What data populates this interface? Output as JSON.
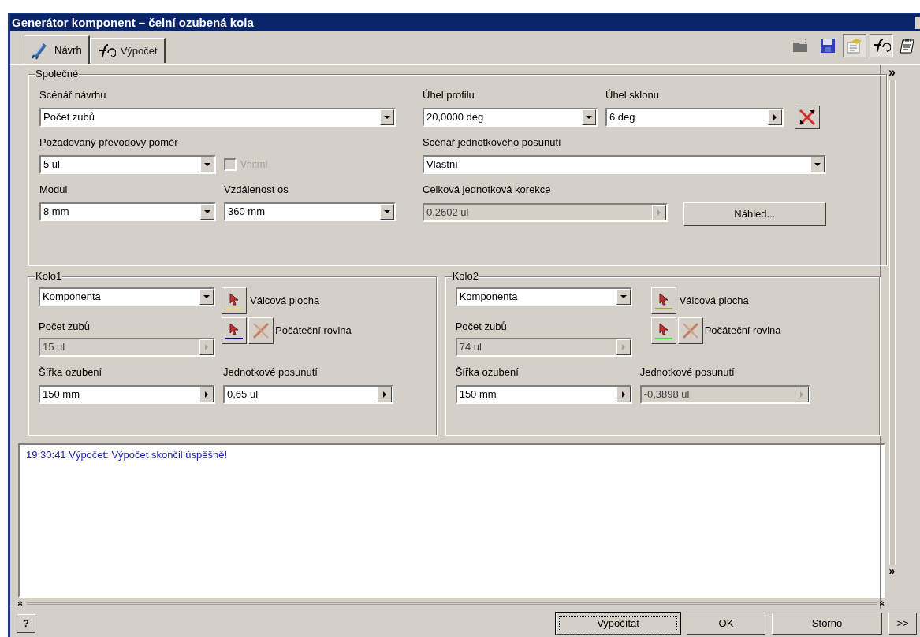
{
  "window": {
    "title": "Generátor komponent – čelní ozubená kola"
  },
  "tabs": [
    {
      "label": "Návrh",
      "selected": true
    },
    {
      "label": "Výpočet",
      "selected": false
    }
  ],
  "toolbar": [
    {
      "kind": "folder",
      "pressed": false
    },
    {
      "kind": "save",
      "pressed": false
    },
    {
      "kind": "note",
      "pressed": true
    },
    {
      "kind": "fx",
      "pressed": true
    },
    {
      "kind": "notepad",
      "pressed": false
    }
  ],
  "side_arrow": "»",
  "common": {
    "legend": "Společné",
    "design_scenario": {
      "label": "Scénář návrhu",
      "value": "Počet zubů",
      "kind": "combo",
      "disabled": false
    },
    "ratio": {
      "label": "Požadovaný převodový poměr",
      "value": "5 ul",
      "kind": "combo",
      "disabled": false
    },
    "internal": {
      "label": "Vnitřní",
      "checked": false,
      "disabled": true
    },
    "module": {
      "label": "Modul",
      "value": "8 mm",
      "kind": "combo",
      "disabled": false
    },
    "center_distance": {
      "label": "Vzdálenost os",
      "value": "360 mm",
      "kind": "combo",
      "disabled": false
    },
    "pressure_angle": {
      "label": "Úhel profilu",
      "value": "20,0000 deg",
      "kind": "combo",
      "disabled": false
    },
    "helix_angle": {
      "label": "Úhel sklonu",
      "value": "6 deg",
      "kind": "spin",
      "disabled": false
    },
    "shift_scenario": {
      "label": "Scénář jednotkového posunutí",
      "value": "Vlastní",
      "kind": "combo",
      "disabled": false
    },
    "total_correction": {
      "label": "Celková jednotková korekce",
      "value": "0,2602 ul",
      "kind": "spin",
      "disabled": true
    },
    "preview_button": "Náhled..."
  },
  "gears": [
    {
      "legend": "Kolo1",
      "type": {
        "value": "Komponenta",
        "kind": "combo",
        "disabled": false
      },
      "cylinder": {
        "label": "Válcová plocha",
        "color": "#e8dc70"
      },
      "start_plane": {
        "label": "Počáteční rovina",
        "color": "#0000a0"
      },
      "teeth": {
        "label": "Počet zubů",
        "value": "15 ul",
        "kind": "spin",
        "disabled": true
      },
      "face_width": {
        "label": "Šířka ozubení",
        "value": "150 mm",
        "kind": "spin",
        "disabled": false
      },
      "unit_shift": {
        "label": "Jednotkové posunutí",
        "value": "0,65 ul",
        "kind": "spin",
        "disabled": false
      }
    },
    {
      "legend": "Kolo2",
      "type": {
        "value": "Komponenta",
        "kind": "combo",
        "disabled": false
      },
      "cylinder": {
        "label": "Válcová plocha",
        "color": "#a8a048"
      },
      "start_plane": {
        "label": "Počáteční rovina",
        "color": "#40e040"
      },
      "teeth": {
        "label": "Počet zubů",
        "value": "74 ul",
        "kind": "spin",
        "disabled": true
      },
      "face_width": {
        "label": "Šířka ozubení",
        "value": "150 mm",
        "kind": "spin",
        "disabled": false
      },
      "unit_shift": {
        "label": "Jednotkové posunutí",
        "value": "-0,3898 ul",
        "kind": "spin",
        "disabled": true
      }
    }
  ],
  "log": {
    "lines": [
      "19:30:41 Výpočet: Výpočet skončil úspěšně!"
    ]
  },
  "splitter": {
    "left": "«",
    "right": "«",
    "side": "»"
  },
  "help_button": "?",
  "buttons": [
    {
      "label": "Vypočítat",
      "focused": true
    },
    {
      "label": "OK",
      "focused": false
    },
    {
      "label": "Storno",
      "focused": false
    }
  ],
  "more_button": ">>"
}
